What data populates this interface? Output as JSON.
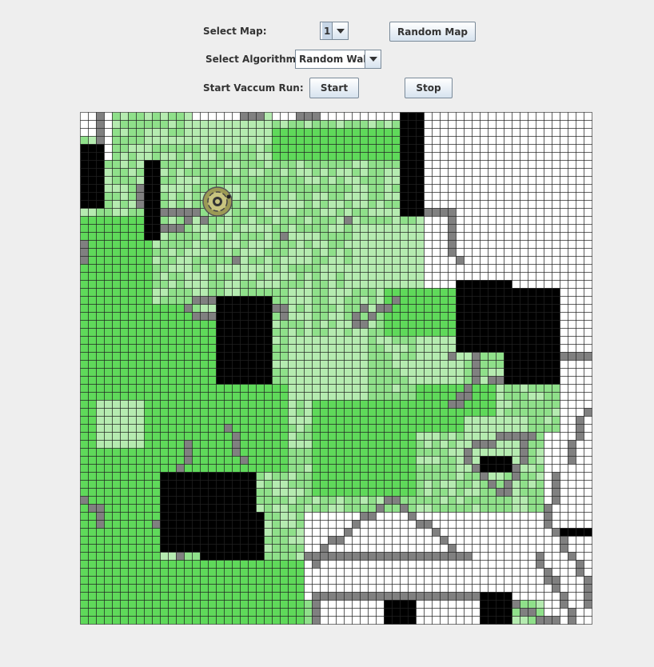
{
  "controls": {
    "select_map_label": "Select Map:",
    "select_map_value": "1",
    "random_map_label": "Random Map",
    "select_algorithm_label": "Select Algorithm:",
    "select_algorithm_value": "Random Walk",
    "start_run_label": "Start Vaccum Run:",
    "start_label": "Start",
    "stop_label": "Stop"
  },
  "grid": {
    "cols": 64,
    "rows": 64,
    "colors": {
      "clean": "#ffffff",
      "light_green": "#b5ebb0",
      "mid_green": "#8fe08a",
      "bright_green": "#5fd95a",
      "wall": "#000000",
      "trail": "#808080",
      "line": "#222222"
    },
    "obstacles": [
      [
        0,
        4,
        3,
        12
      ],
      [
        8,
        6,
        10,
        16
      ],
      [
        40,
        0,
        43,
        13
      ],
      [
        17,
        23,
        24,
        34
      ],
      [
        47,
        21,
        54,
        30
      ],
      [
        53,
        22,
        60,
        34
      ],
      [
        10,
        45,
        22,
        55
      ],
      [
        15,
        50,
        23,
        56
      ],
      [
        50,
        43,
        54,
        45
      ],
      [
        38,
        61,
        42,
        64
      ],
      [
        50,
        60,
        54,
        64
      ],
      [
        60,
        52,
        64,
        53
      ]
    ],
    "clean_regions": [
      [
        0,
        0,
        3,
        3
      ],
      [
        3,
        0,
        4,
        6
      ],
      [
        14,
        0,
        20,
        1
      ],
      [
        24,
        0,
        40,
        1
      ],
      [
        43,
        0,
        64,
        22
      ],
      [
        56,
        22,
        64,
        30
      ],
      [
        60,
        30,
        64,
        33
      ],
      [
        60,
        33,
        64,
        40
      ],
      [
        58,
        40,
        64,
        64
      ],
      [
        28,
        50,
        58,
        55
      ],
      [
        42,
        55,
        58,
        61
      ],
      [
        28,
        55,
        42,
        61
      ],
      [
        29,
        61,
        38,
        64
      ],
      [
        42,
        61,
        50,
        64
      ]
    ],
    "bright_regions": [
      [
        0,
        13,
        9,
        64
      ],
      [
        9,
        26,
        18,
        45
      ],
      [
        5,
        45,
        10,
        64
      ],
      [
        10,
        56,
        28,
        64
      ],
      [
        24,
        2,
        40,
        6
      ],
      [
        16,
        34,
        26,
        45
      ],
      [
        4,
        24,
        14,
        34
      ],
      [
        38,
        18,
        48,
        28
      ],
      [
        42,
        34,
        52,
        40
      ],
      [
        29,
        36,
        42,
        48
      ]
    ],
    "light_regions": [
      [
        14,
        1,
        24,
        4
      ],
      [
        34,
        14,
        44,
        22
      ],
      [
        26,
        28,
        36,
        36
      ],
      [
        2,
        36,
        8,
        42
      ],
      [
        42,
        28,
        48,
        34
      ],
      [
        48,
        38,
        56,
        44
      ]
    ],
    "trail_cells": [
      [
        2,
        0
      ],
      [
        2,
        1
      ],
      [
        2,
        2
      ],
      [
        2,
        3
      ],
      [
        7,
        9
      ],
      [
        7,
        10
      ],
      [
        7,
        11
      ],
      [
        20,
        0
      ],
      [
        21,
        0
      ],
      [
        22,
        0
      ],
      [
        27,
        0
      ],
      [
        28,
        0
      ],
      [
        29,
        0
      ],
      [
        10,
        12
      ],
      [
        11,
        12
      ],
      [
        12,
        12
      ],
      [
        13,
        12
      ],
      [
        14,
        12
      ],
      [
        15,
        13
      ],
      [
        10,
        14
      ],
      [
        11,
        14
      ],
      [
        12,
        14
      ],
      [
        13,
        13
      ],
      [
        33,
        13
      ],
      [
        25,
        15
      ],
      [
        19,
        18
      ],
      [
        0,
        16
      ],
      [
        0,
        17
      ],
      [
        0,
        18
      ],
      [
        43,
        12
      ],
      [
        44,
        12
      ],
      [
        45,
        12
      ],
      [
        46,
        12
      ],
      [
        46,
        13
      ],
      [
        46,
        14
      ],
      [
        46,
        15
      ],
      [
        46,
        16
      ],
      [
        46,
        17
      ],
      [
        47,
        18
      ],
      [
        14,
        23
      ],
      [
        15,
        23
      ],
      [
        16,
        23
      ],
      [
        13,
        24
      ],
      [
        14,
        25
      ],
      [
        15,
        25
      ],
      [
        16,
        25
      ],
      [
        24,
        24
      ],
      [
        25,
        24
      ],
      [
        25,
        25
      ],
      [
        36,
        25
      ],
      [
        37,
        24
      ],
      [
        38,
        24
      ],
      [
        39,
        23
      ],
      [
        34,
        26
      ],
      [
        35,
        26
      ],
      [
        34,
        25
      ],
      [
        35,
        24
      ],
      [
        49,
        30
      ],
      [
        49,
        31
      ],
      [
        49,
        32
      ],
      [
        49,
        33
      ],
      [
        48,
        34
      ],
      [
        48,
        35
      ],
      [
        47,
        35
      ],
      [
        46,
        36
      ],
      [
        47,
        36
      ],
      [
        46,
        30
      ],
      [
        51,
        33
      ],
      [
        52,
        33
      ],
      [
        60,
        30
      ],
      [
        61,
        30
      ],
      [
        62,
        30
      ],
      [
        63,
        30
      ],
      [
        63,
        37
      ],
      [
        62,
        38
      ],
      [
        62,
        39
      ],
      [
        62,
        40
      ],
      [
        61,
        41
      ],
      [
        61,
        42
      ],
      [
        61,
        43
      ],
      [
        18,
        39
      ],
      [
        19,
        40
      ],
      [
        19,
        41
      ],
      [
        19,
        42
      ],
      [
        20,
        43
      ],
      [
        13,
        41
      ],
      [
        13,
        42
      ],
      [
        13,
        43
      ],
      [
        12,
        44
      ],
      [
        48,
        42
      ],
      [
        49,
        41
      ],
      [
        50,
        41
      ],
      [
        51,
        41
      ],
      [
        52,
        40
      ],
      [
        53,
        40
      ],
      [
        54,
        40
      ],
      [
        55,
        40
      ],
      [
        56,
        40
      ],
      [
        55,
        41
      ],
      [
        55,
        42
      ],
      [
        55,
        43
      ],
      [
        54,
        44
      ],
      [
        54,
        45
      ],
      [
        53,
        46
      ],
      [
        53,
        47
      ],
      [
        52,
        47
      ],
      [
        51,
        46
      ],
      [
        50,
        45
      ],
      [
        49,
        44
      ],
      [
        48,
        43
      ],
      [
        0,
        48
      ],
      [
        1,
        49
      ],
      [
        2,
        49
      ],
      [
        2,
        50
      ],
      [
        2,
        51
      ],
      [
        9,
        51
      ],
      [
        39,
        48
      ],
      [
        40,
        49
      ],
      [
        41,
        50
      ],
      [
        42,
        51
      ],
      [
        43,
        51
      ],
      [
        44,
        52
      ],
      [
        45,
        53
      ],
      [
        46,
        54
      ],
      [
        38,
        48
      ],
      [
        37,
        49
      ],
      [
        36,
        50
      ],
      [
        35,
        50
      ],
      [
        34,
        51
      ],
      [
        33,
        52
      ],
      [
        32,
        53
      ],
      [
        31,
        53
      ],
      [
        30,
        54
      ],
      [
        29,
        55
      ],
      [
        29,
        56
      ],
      [
        28,
        55
      ],
      [
        29,
        55
      ],
      [
        30,
        55
      ],
      [
        31,
        55
      ],
      [
        32,
        55
      ],
      [
        33,
        55
      ],
      [
        34,
        55
      ],
      [
        35,
        55
      ],
      [
        36,
        55
      ],
      [
        37,
        55
      ],
      [
        38,
        55
      ],
      [
        39,
        55
      ],
      [
        40,
        55
      ],
      [
        41,
        55
      ],
      [
        42,
        55
      ],
      [
        43,
        55
      ],
      [
        44,
        55
      ],
      [
        45,
        55
      ],
      [
        46,
        55
      ],
      [
        47,
        55
      ],
      [
        48,
        55
      ],
      [
        59,
        45
      ],
      [
        59,
        46
      ],
      [
        59,
        47
      ],
      [
        59,
        48
      ],
      [
        58,
        49
      ],
      [
        58,
        50
      ],
      [
        58,
        51
      ],
      [
        59,
        52
      ],
      [
        60,
        53
      ],
      [
        60,
        54
      ],
      [
        61,
        55
      ],
      [
        62,
        56
      ],
      [
        62,
        57
      ],
      [
        63,
        58
      ],
      [
        63,
        59
      ],
      [
        63,
        60
      ],
      [
        63,
        61
      ],
      [
        29,
        60
      ],
      [
        29,
        61
      ],
      [
        29,
        62
      ],
      [
        29,
        63
      ],
      [
        30,
        60
      ],
      [
        31,
        60
      ],
      [
        32,
        60
      ],
      [
        33,
        60
      ],
      [
        34,
        60
      ],
      [
        35,
        60
      ],
      [
        36,
        60
      ],
      [
        37,
        60
      ],
      [
        38,
        60
      ],
      [
        39,
        60
      ],
      [
        40,
        60
      ],
      [
        41,
        60
      ],
      [
        42,
        60
      ],
      [
        43,
        60
      ],
      [
        44,
        60
      ],
      [
        45,
        60
      ],
      [
        46,
        60
      ],
      [
        47,
        60
      ],
      [
        48,
        60
      ],
      [
        49,
        60
      ],
      [
        57,
        55
      ],
      [
        57,
        56
      ],
      [
        58,
        57
      ],
      [
        58,
        58
      ],
      [
        59,
        58
      ],
      [
        59,
        59
      ],
      [
        60,
        60
      ],
      [
        60,
        61
      ],
      [
        61,
        62
      ],
      [
        54,
        61
      ],
      [
        55,
        62
      ],
      [
        56,
        62
      ],
      [
        57,
        63
      ],
      [
        58,
        63
      ],
      [
        12,
        55
      ],
      [
        59,
        63
      ],
      [
        61,
        63
      ]
    ],
    "robot": {
      "col": 16,
      "row": 11
    }
  }
}
